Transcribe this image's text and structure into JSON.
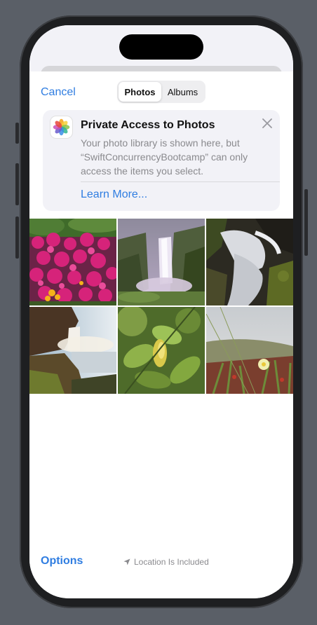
{
  "header": {
    "cancel_label": "Cancel",
    "tabs": [
      {
        "label": "Photos",
        "selected": true
      },
      {
        "label": "Albums",
        "selected": false
      }
    ]
  },
  "notice": {
    "icon": "photos-app-icon",
    "title": "Private Access to Photos",
    "body": "Your photo library is shown here, but “SwiftConcurrencyBootcamp” can only access the items you select.",
    "link_label": "Learn More..."
  },
  "photos": [
    {
      "subject": "pink-flowers"
    },
    {
      "subject": "waterfall-canyon"
    },
    {
      "subject": "waterfall-rocks"
    },
    {
      "subject": "waterfall-cliff"
    },
    {
      "subject": "green-leaves"
    },
    {
      "subject": "ice-plant-flowers"
    }
  ],
  "footer": {
    "options_label": "Options",
    "location_text": "Location Is Included",
    "location_icon": "location-arrow-icon"
  },
  "colors": {
    "accent": "#2f7de1",
    "secondary_text": "#8a8a8e"
  }
}
